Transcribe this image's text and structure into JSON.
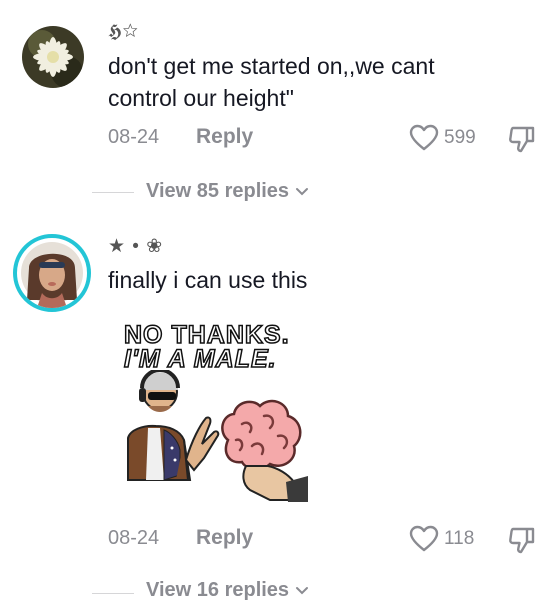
{
  "comments": [
    {
      "username": "𝕳☆",
      "text_lines": [
        "don't get me started on,,we cant",
        "control our height\""
      ],
      "date": "08-24",
      "reply_label": "Reply",
      "likes": "599",
      "view_replies": "View 85 replies"
    },
    {
      "username": "★ • ❀",
      "text": "finally i can use this",
      "sticker_lines": [
        "NO THANKS.",
        "I'M A MALE."
      ],
      "date": "08-24",
      "reply_label": "Reply",
      "likes": "118",
      "view_replies": "View 16 replies"
    }
  ]
}
